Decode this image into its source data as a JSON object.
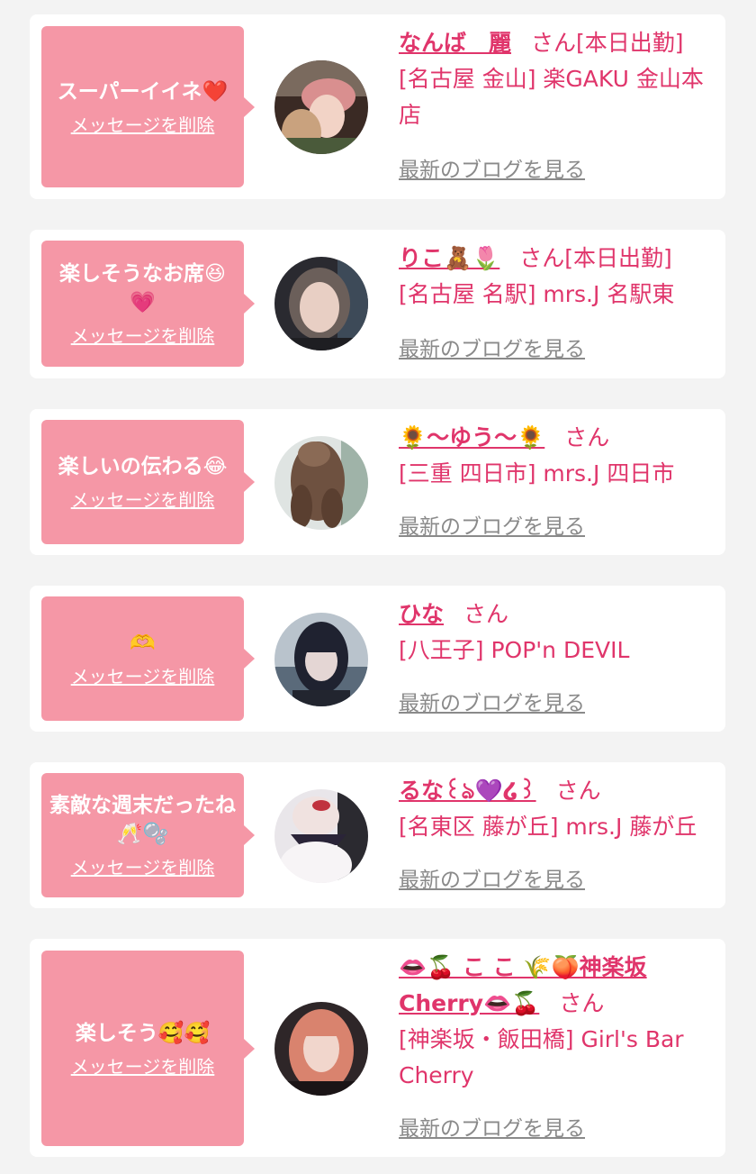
{
  "delete_label": "メッセージを削除",
  "blog_label": "最新のブログを見る",
  "honorific": "さん",
  "cards": [
    {
      "message": "スーパーイイネ❤️",
      "name": "なんば　麗",
      "status": "[本日出勤]",
      "shop": "[名古屋 金山] 楽GAKU 金山本店"
    },
    {
      "message": "楽しそうなお席😆💗",
      "name": "りこ🧸🌷",
      "status": "[本日出勤]",
      "shop": "[名古屋 名駅] mrs.J 名駅東"
    },
    {
      "message": "楽しいの伝わる😂",
      "name": "🌻〜ゆう〜🌻",
      "status": "",
      "shop": "[三重 四日市] mrs.J 四日市"
    },
    {
      "message": "🫶",
      "name": "ひな",
      "status": "",
      "shop": "[八王子] POP'n DEVIL"
    },
    {
      "message": "素敵な週末だったね🥂🫧",
      "name": "るな꒰ঌ💜໒꒱",
      "status": "",
      "shop": "[名東区 藤が丘] mrs.J 藤が丘"
    },
    {
      "message": "楽しそう🥰🥰",
      "name": "👄🍒 こ こ 🌾🍑神楽坂Cherry👄🍒",
      "status": "",
      "shop": "[神楽坂・飯田橋] Girl's Bar Cherry"
    }
  ]
}
